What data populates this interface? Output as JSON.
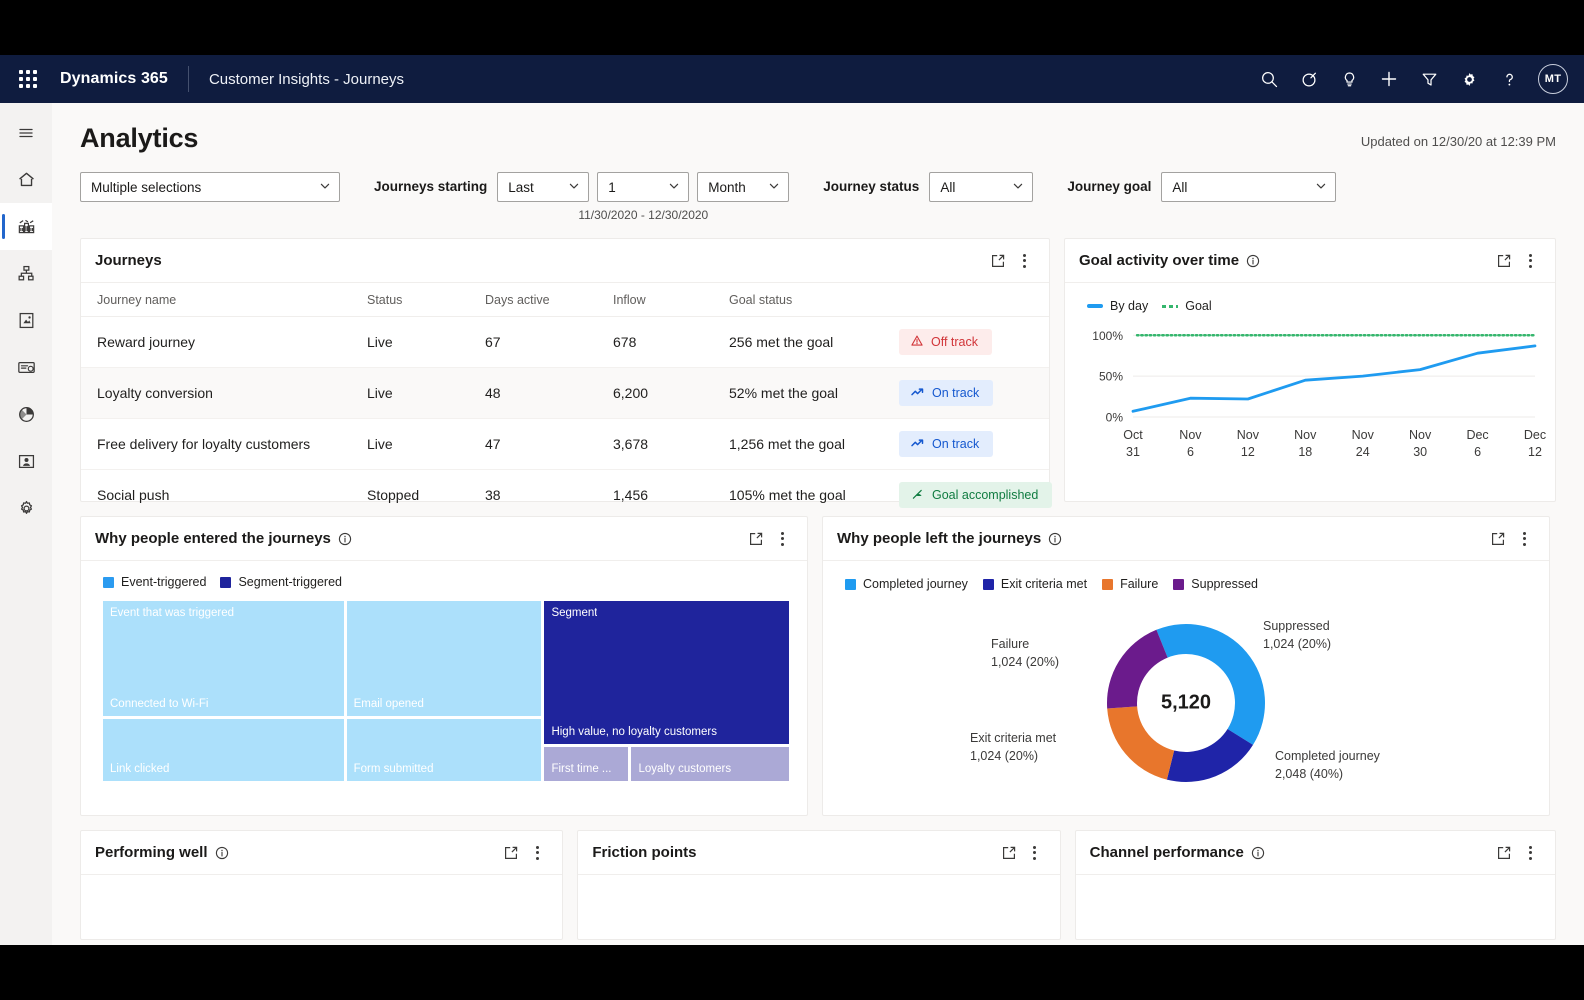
{
  "topbar": {
    "waffle_label": "App launcher",
    "brand": "Dynamics 365",
    "app_name": "Customer Insights - Journeys",
    "icons": [
      "search-icon",
      "focus-target-icon",
      "lightbulb-icon",
      "plus-icon",
      "filter-icon",
      "gear-icon",
      "help-icon"
    ],
    "avatar_initials": "MT"
  },
  "sidebar": {
    "items": [
      {
        "name": "menu-toggle",
        "label": "Menu",
        "selected": false
      },
      {
        "name": "home",
        "label": "Home",
        "selected": false
      },
      {
        "name": "analytics",
        "label": "Analytics",
        "selected": true
      },
      {
        "name": "journeys",
        "label": "Journeys",
        "selected": false
      },
      {
        "name": "content",
        "label": "Content",
        "selected": false
      },
      {
        "name": "emails",
        "label": "Emails",
        "selected": false
      },
      {
        "name": "insights",
        "label": "Insights",
        "selected": false
      },
      {
        "name": "segments",
        "label": "Segments",
        "selected": false
      },
      {
        "name": "settings",
        "label": "Settings",
        "selected": false
      }
    ]
  },
  "page": {
    "title": "Analytics",
    "updated": "Updated on 12/30/20 at 12:39 PM"
  },
  "filters": {
    "multi_select_value": "Multiple selections",
    "journeys_starting_label": "Journeys starting",
    "range_mode": "Last",
    "range_count": "1",
    "range_unit": "Month",
    "date_range": "11/30/2020 - 12/30/2020",
    "journey_status_label": "Journey status",
    "journey_status_value": "All",
    "journey_goal_label": "Journey goal",
    "journey_goal_value": "All"
  },
  "journeys_card": {
    "title": "Journeys",
    "columns": [
      "Journey name",
      "Status",
      "Days active",
      "Inflow",
      "Goal status"
    ],
    "rows": [
      {
        "name": "Reward journey",
        "status": "Live",
        "days_active": "67",
        "inflow": "678",
        "goal_status": "256 met the goal",
        "badge": "Off track",
        "badge_kind": "off"
      },
      {
        "name": "Loyalty conversion",
        "status": "Live",
        "days_active": "48",
        "inflow": "6,200",
        "goal_status": "52% met the goal",
        "badge": "On track",
        "badge_kind": "on"
      },
      {
        "name": "Free delivery for loyalty customers",
        "status": "Live",
        "days_active": "47",
        "inflow": "3,678",
        "goal_status": "1,256 met the goal",
        "badge": "On track",
        "badge_kind": "on"
      },
      {
        "name": "Social push",
        "status": "Stopped",
        "days_active": "38",
        "inflow": "1,456",
        "goal_status": "105% met the goal",
        "badge": "Goal accomplished",
        "badge_kind": "acc"
      }
    ]
  },
  "goal_card": {
    "title": "Goal activity over time"
  },
  "tree_card": {
    "title": "Why people entered the journeys"
  },
  "left_card": {
    "title": "Why people left the journeys"
  },
  "bottom_cards": [
    {
      "title": "Performing well",
      "has_info": true
    },
    {
      "title": "Friction points",
      "has_info": false
    },
    {
      "title": "Channel performance",
      "has_info": true
    }
  ],
  "chart_data": [
    {
      "type": "line",
      "title": "Goal activity over time",
      "xlabel": "",
      "ylabel": "",
      "ylim": [
        0,
        115
      ],
      "yticks": [
        0,
        50,
        100
      ],
      "ytick_labels": [
        "0%",
        "50%",
        "100%"
      ],
      "grid": true,
      "legend_position": "top-left",
      "legend": [
        "By day",
        "Goal"
      ],
      "x": [
        "Oct 31",
        "Nov 6",
        "Nov 12",
        "Nov 18",
        "Nov 24",
        "Nov 30",
        "Dec 6",
        "Dec 12"
      ],
      "series": [
        {
          "name": "By day",
          "color": "#1f9bf0",
          "style": "solid",
          "values": [
            7,
            23,
            22,
            45,
            50,
            58,
            78,
            87
          ]
        },
        {
          "name": "Goal",
          "color": "#35b66d",
          "style": "dotted",
          "values": [
            100,
            100,
            100,
            100,
            100,
            100,
            100,
            100
          ]
        }
      ]
    },
    {
      "type": "treemap",
      "title": "Why people entered the journeys",
      "legend": [
        {
          "label": "Event-triggered",
          "color": "#2b9bf0"
        },
        {
          "label": "Segment-triggered",
          "color": "#1f249c"
        }
      ],
      "groups": [
        {
          "group": "Event-triggered",
          "color": "#ace0fb",
          "tiles": [
            {
              "label": "Event that was triggered",
              "position": "top"
            },
            {
              "label": "Connected to Wi-Fi",
              "position": "bottom"
            },
            {
              "label": "Email opened",
              "position": "bottom"
            },
            {
              "label": "Link clicked",
              "position": "bottom"
            },
            {
              "label": "Form submitted",
              "position": "bottom"
            }
          ]
        },
        {
          "group": "Segment-triggered",
          "color": "#1f249c",
          "tiles": [
            {
              "label": "Segment",
              "position": "top"
            },
            {
              "label": "High value, no loyalty customers",
              "position": "bottom"
            },
            {
              "label": "First time ...",
              "position": "bottom",
              "color": "#aba9d6"
            },
            {
              "label": "Loyalty customers",
              "position": "bottom",
              "color": "#aba9d6"
            }
          ]
        }
      ]
    },
    {
      "type": "pie",
      "subtype": "donut",
      "title": "Why people left the journeys",
      "center_value": "5,120",
      "total": 5120,
      "legend_position": "top-left",
      "legend": [
        "Completed journey",
        "Exit criteria met",
        "Failure",
        "Suppressed"
      ],
      "labels": [
        "Completed journey",
        "Exit criteria met",
        "Failure",
        "Suppressed"
      ],
      "values": [
        2048,
        1024,
        1024,
        1024
      ],
      "percents": [
        40,
        20,
        20,
        20
      ],
      "colors": [
        "#1f9bf0",
        "#1f24a8",
        "#e8762c",
        "#6b1b8c"
      ],
      "annotations": [
        {
          "label": "Completed journey",
          "value": "2,048 (40%)"
        },
        {
          "label": "Exit criteria met",
          "value": "1,024 (20%)"
        },
        {
          "label": "Failure",
          "value": "1,024 (20%)"
        },
        {
          "label": "Suppressed",
          "value": "1,024 (20%)"
        }
      ]
    }
  ]
}
